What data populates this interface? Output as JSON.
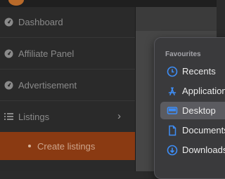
{
  "sidebar": {
    "items": [
      {
        "label": "Dashboard",
        "icon": "dashboard-icon"
      },
      {
        "label": "Affiliate Panel",
        "icon": "dashboard-icon"
      },
      {
        "label": "Advertisement",
        "icon": "dashboard-icon"
      },
      {
        "label": "Listings",
        "icon": "list-icon",
        "chevron": "›"
      }
    ],
    "active_subitem": "Create listings"
  },
  "finder": {
    "section_title": "Favourites",
    "items": [
      {
        "label": "Recents",
        "icon": "clock-icon"
      },
      {
        "label": "Applications",
        "icon": "apps-icon"
      },
      {
        "label": "Desktop",
        "icon": "desktop-icon",
        "selected": true
      },
      {
        "label": "Documents",
        "icon": "document-icon"
      },
      {
        "label": "Downloads",
        "icon": "download-icon"
      }
    ]
  },
  "colors": {
    "accent": "#8a3a12",
    "finder_icon": "#3e8ef7"
  }
}
